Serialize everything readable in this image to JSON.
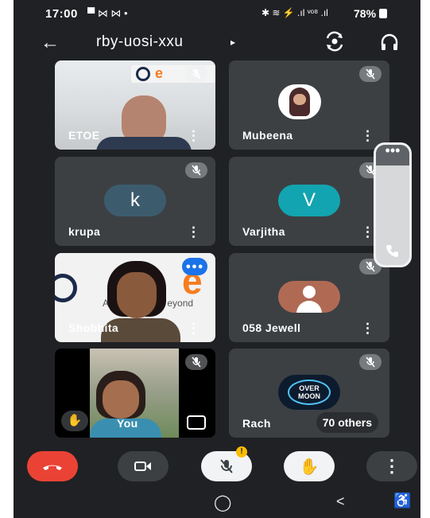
{
  "status_bar": {
    "time": "17:00",
    "notif_icons": "▀ ⋈ ⋈ •",
    "system_icons": "✱ ≋ ⚡ .ıl ᵛᵒ⁸ .ıl",
    "battery": "78%"
  },
  "meeting": {
    "code": "rby-uosi-xxu",
    "code_chevron": "▸"
  },
  "participants": [
    {
      "name": "ETOE",
      "type": "video",
      "muted": true
    },
    {
      "name": "Mubeena",
      "type": "avatar",
      "avatar_kind": "photo",
      "muted": true
    },
    {
      "name": "krupa",
      "type": "avatar",
      "letter": "k",
      "avatar_color": "#3c5c6e",
      "muted": true
    },
    {
      "name": "Varjitha",
      "type": "avatar",
      "letter": "V",
      "avatar_color": "#12a4b0",
      "muted": true
    },
    {
      "name": "Shobhita",
      "type": "video",
      "speaking": true,
      "speaking_dots": "●●●"
    },
    {
      "name": "058 Jewell",
      "type": "avatar",
      "avatar_kind": "generic",
      "avatar_color": "#b06a54",
      "muted": true
    },
    {
      "name": "You",
      "type": "self",
      "muted": true
    },
    {
      "name": "Rach",
      "type": "avatar",
      "avatar_kind": "logo",
      "overflow_label": "70 others",
      "muted": true
    }
  ],
  "side_panel": {
    "menu_label": "•••"
  },
  "controls": {
    "end_call_color": "#ea4335",
    "warning_badge": "!"
  },
  "colors": {
    "background": "#202124",
    "tile": "#3c4043",
    "end_call": "#ea4335",
    "warning": "#fbbc04"
  },
  "navbar": {
    "recents": "",
    "home": "◯",
    "back": "<",
    "accessibility": "♿"
  }
}
